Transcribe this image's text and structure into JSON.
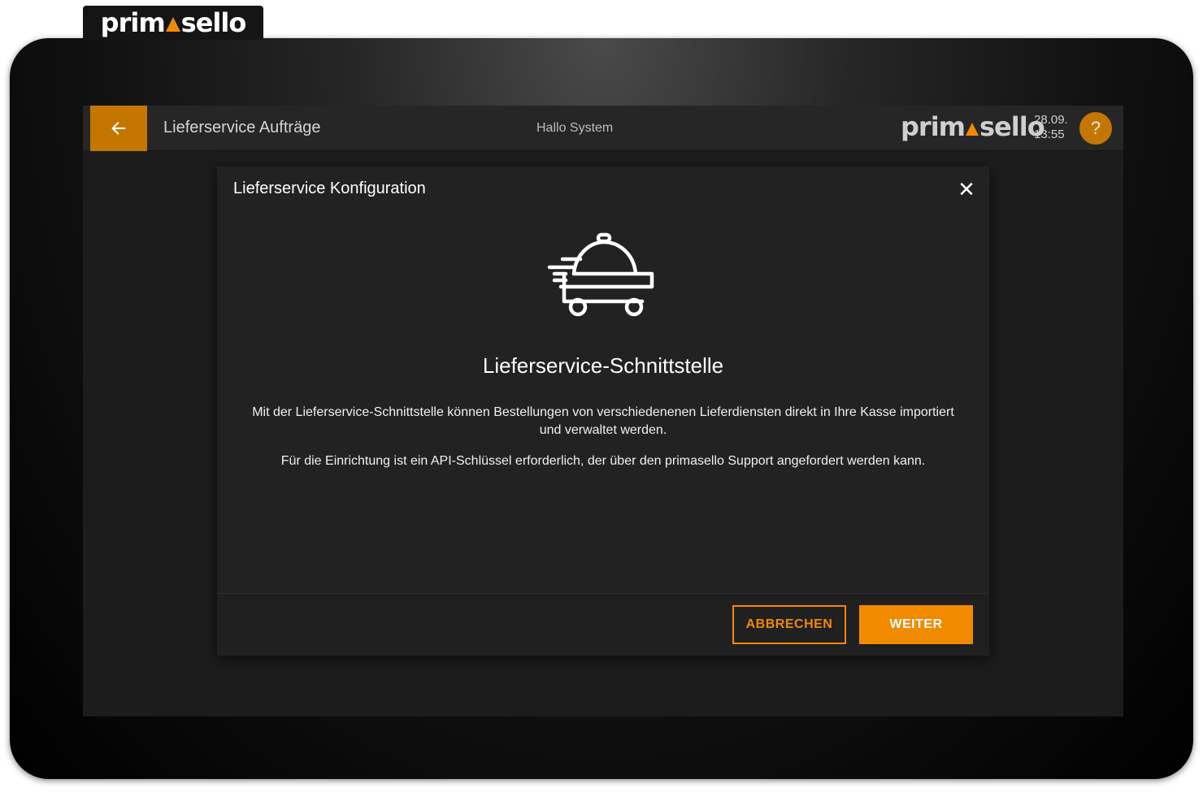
{
  "brand": {
    "logo_part1": "prim",
    "logo_part2": "sello",
    "accent_color": "#f28a00"
  },
  "topbar": {
    "back_icon": "arrow-left-icon",
    "title": "Lieferservice Aufträge",
    "greeting": "Hallo System",
    "date": "28.09.",
    "time": "13:55",
    "help_label": "?"
  },
  "modal": {
    "title": "Lieferservice Konfiguration",
    "close_label": "✕",
    "icon": "delivery-cart-icon",
    "heading": "Lieferservice-Schnittstelle",
    "paragraph1": "Mit der Lieferservice-Schnittstelle können Bestellungen von verschiedenenen Lieferdiensten direkt in Ihre Kasse importiert und verwaltet werden.",
    "paragraph2": "Für die Einrichtung ist ein API-Schlüssel erforderlich, der über den primasello Support angefordert werden kann.",
    "cancel_label": "ABBRECHEN",
    "next_label": "WEITER"
  }
}
